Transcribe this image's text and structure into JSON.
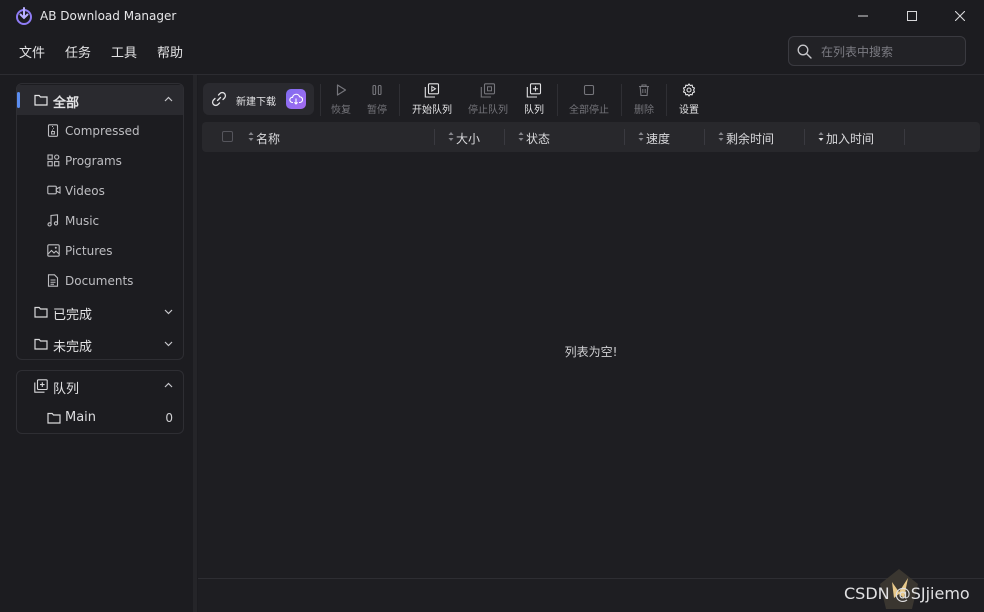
{
  "window": {
    "title": "AB Download Manager",
    "controls": [
      "minimize",
      "maximize",
      "close"
    ]
  },
  "menu": [
    "文件",
    "任务",
    "工具",
    "帮助"
  ],
  "search": {
    "placeholder": "在列表中搜索"
  },
  "categories": {
    "all": {
      "label": "全部",
      "items": [
        {
          "label": "Compressed",
          "icon": "compressed-file-icon"
        },
        {
          "label": "Programs",
          "icon": "programs-icon"
        },
        {
          "label": "Videos",
          "icon": "video-icon"
        },
        {
          "label": "Music",
          "icon": "music-icon"
        },
        {
          "label": "Pictures",
          "icon": "picture-icon"
        },
        {
          "label": "Documents",
          "icon": "document-icon"
        }
      ]
    },
    "finished": {
      "label": "已完成"
    },
    "unfinished": {
      "label": "未完成"
    }
  },
  "queues": {
    "label": "队列",
    "items": [
      {
        "label": "Main",
        "count": "0"
      }
    ]
  },
  "toolbar": {
    "new_download": "新建下载",
    "resume": "恢复",
    "pause": "暂停",
    "start_queue": "开始队列",
    "stop_queue": "停止队列",
    "queue": "队列",
    "stop_all": "全部停止",
    "delete": "删除",
    "settings": "设置"
  },
  "table": {
    "columns": [
      "名称",
      "大小",
      "状态",
      "速度",
      "剩余时间",
      "加入时间"
    ],
    "empty_message": "列表为空!"
  },
  "watermark": "CSDN @SJjiemo",
  "colors": {
    "background": "#1c1c20",
    "accent": "#5b8def",
    "cloud_button": "#8a6cf0"
  }
}
